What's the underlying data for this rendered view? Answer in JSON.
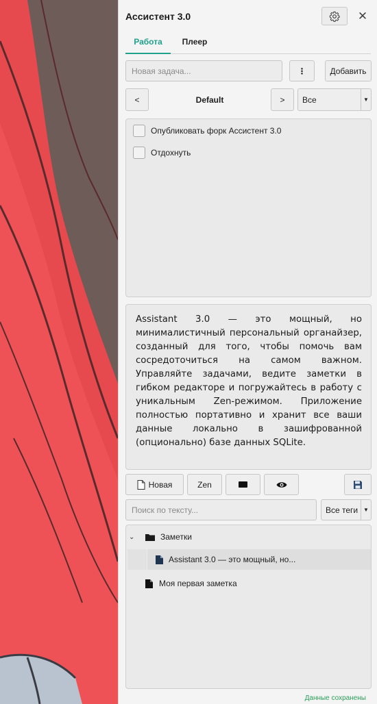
{
  "app": {
    "title": "Ассистент 3.0"
  },
  "tabs": [
    {
      "label": "Работа",
      "active": true
    },
    {
      "label": "Плеер",
      "active": false
    }
  ],
  "task_input": {
    "placeholder": "Новая задача...",
    "more_label": "⋮",
    "add_label": "Добавить"
  },
  "list_nav": {
    "prev": "<",
    "next": ">",
    "list_name": "Default",
    "filter": "Все"
  },
  "tasks": [
    {
      "label": "Опубликовать форк Ассистент 3.0",
      "checked": false
    },
    {
      "label": "Отдохнуть",
      "checked": false
    }
  ],
  "note": {
    "text": "Assistant 3.0 — это мощный, но минималистичный персональный органайзер, созданный для того, чтобы помочь вам сосредоточиться на самом важном. Управляйте задачами, ведите заметки в гибком редакторе и погружайтесь в работу с уникальным Zen-режимом. Приложение полностью портативно и хранит все ваши данные локально в зашифрованной (опционально) базе данных SQLite."
  },
  "note_toolbar": {
    "new_label": "Новая",
    "zen_label": "Zen"
  },
  "search": {
    "placeholder": "Поиск по тексту...",
    "tags_filter": "Все теги"
  },
  "tree": {
    "folder": "Заметки",
    "items": [
      "Assistant 3.0 — это мощный, но...",
      "Моя первая заметка"
    ]
  },
  "status": "Данные сохранены",
  "colors": {
    "accent": "#20a08c",
    "status": "#2a9d5a",
    "background_art": "#e84a4f"
  }
}
